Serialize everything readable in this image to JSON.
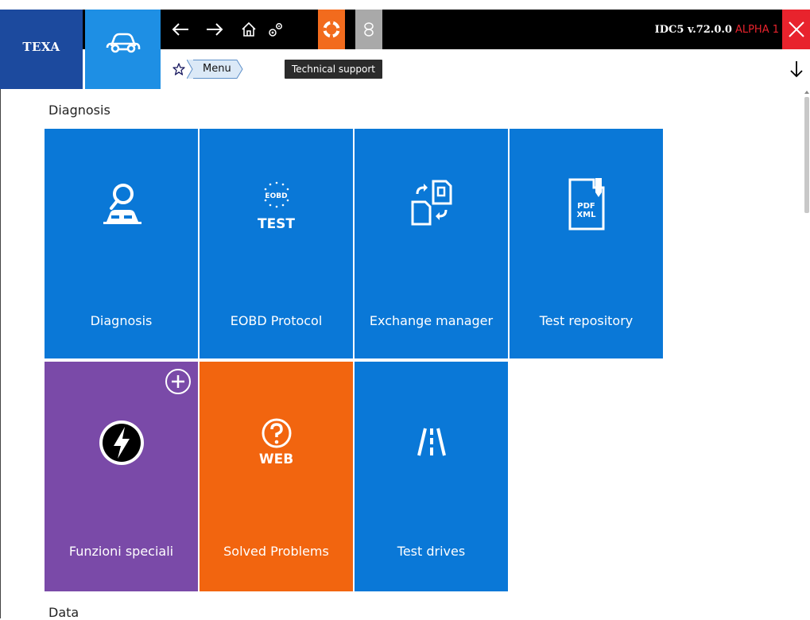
{
  "header": {
    "brand": "TEXA",
    "version": "IDC5 v.72.0.0",
    "version_tag": "ALPHA 1",
    "tooltip": "Technical support",
    "breadcrumb": [
      "Menu"
    ],
    "nav_icons": [
      "back-icon",
      "forward-icon",
      "home-icon",
      "settings-icon",
      "technical-support-icon",
      "link-icon"
    ]
  },
  "sections": [
    {
      "title": "Diagnosis",
      "tiles": [
        {
          "label": "Diagnosis",
          "icon": "diagnosis-search-icon",
          "color": "#0a78d7"
        },
        {
          "label": "EOBD Protocol",
          "icon": "eobd-test-icon",
          "color": "#0a78d7",
          "icon_text_top": "EOBD",
          "icon_text_bottom": "TEST"
        },
        {
          "label": "Exchange manager",
          "icon": "exchange-icon",
          "color": "#0a78d7"
        },
        {
          "label": "Test repository",
          "icon": "pdf-xml-icon",
          "color": "#0a78d7",
          "icon_text_top": "PDF",
          "icon_text_bottom": "XML"
        },
        {
          "label": "Funzioni speciali",
          "icon": "lightning-icon",
          "color": "#7a4aa8"
        },
        {
          "label": "Solved Problems",
          "icon": "help-web-icon",
          "color": "#f2650f",
          "icon_text_bottom": "WEB"
        },
        {
          "label": "Test drives",
          "icon": "road-icon",
          "color": "#0a78d7"
        }
      ]
    },
    {
      "title": "Data"
    }
  ],
  "colors": {
    "accent_blue": "#0a78d7",
    "logo_blue": "#1c4a9e",
    "close_red": "#e8232d",
    "support_orange": "#f26b1d"
  }
}
